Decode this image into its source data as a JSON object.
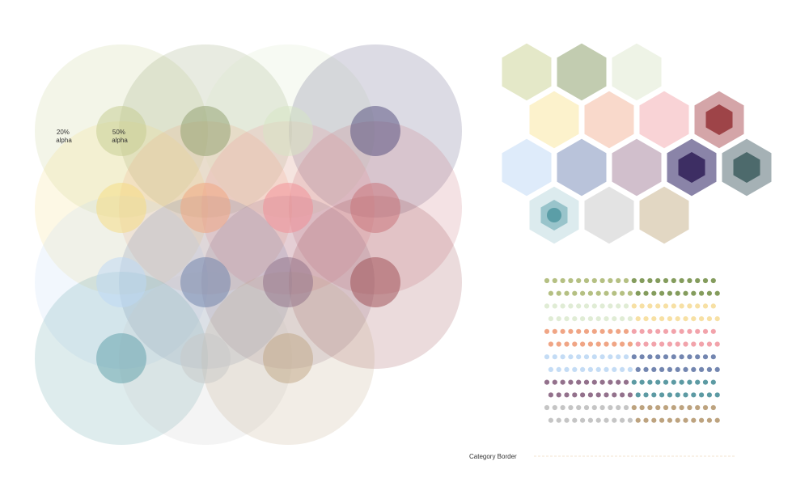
{
  "labels": {
    "alpha20": [
      "20%",
      "alpha"
    ],
    "alpha50": [
      "50%",
      "alpha"
    ],
    "category_border": "Category Border"
  },
  "colors": {
    "category_border": "#f3e3cf",
    "hex_border": "#ffffff",
    "label_text": "#333333"
  },
  "opacity": {
    "large": 0.2,
    "small": 0.5
  },
  "circle_grid": [
    [
      "#c3cc8d",
      "#8d9d6b",
      "#d6e6c4",
      "#4f4a7a"
    ],
    [
      "#f6dc7e",
      "#f1a37d",
      "#f28b93",
      "#c76f76"
    ],
    [
      "#bcd8f6",
      "#6c80a9",
      "#8e6e86",
      "#9b4a50"
    ],
    [
      "#5b9ea7",
      "#c7c7c7",
      "#bfa684",
      null
    ]
  ],
  "hex_swatches": [
    {
      "row": 0,
      "col": 0,
      "color": "#e4e8c8"
    },
    {
      "row": 0,
      "col": 1,
      "color": "#c2ccb0"
    },
    {
      "row": 0,
      "col": 2,
      "color": "#eef3e6"
    },
    {
      "row": 1,
      "col": 0,
      "color": "#fcf2cc"
    },
    {
      "row": 1,
      "col": 1,
      "color": "#f9d9cb"
    },
    {
      "row": 1,
      "col": 2,
      "color": "#f9d3d6"
    },
    {
      "row": 1,
      "col": 3,
      "color": "#d4a5a8",
      "inner": "#9e4448"
    },
    {
      "row": 2,
      "col": 0,
      "color": "#deebfa"
    },
    {
      "row": 2,
      "col": 1,
      "color": "#b9c3da"
    },
    {
      "row": 2,
      "col": 2,
      "color": "#d1bfcc"
    },
    {
      "row": 2,
      "col": 3,
      "color": "#8a84a8",
      "inner": "#3d2e63"
    },
    {
      "row": 2,
      "col": 4,
      "color": "#a5b1b5",
      "inner": "#4d6a6c"
    },
    {
      "row": 3,
      "col": 0,
      "color": "#dcebee",
      "inner": "#99c4cb",
      "inner2": "#5b9ea7"
    },
    {
      "row": 3,
      "col": 1,
      "color": "#e3e3e3"
    },
    {
      "row": 3,
      "col": 2,
      "color": "#e2d7c3"
    }
  ],
  "dot_rows": [
    [
      "#b5c083",
      "#849c5d"
    ],
    [
      "#b5c083",
      "#849c5d"
    ],
    [
      "#e0ecd5",
      "#f7e0a4"
    ],
    [
      "#e0ecd5",
      "#f7e0a4"
    ],
    [
      "#f0a585",
      "#f2a3ab"
    ],
    [
      "#f0a585",
      "#f2a3ab"
    ],
    [
      "#c4dcf5",
      "#7386b0"
    ],
    [
      "#c4dcf5",
      "#7386b0"
    ],
    [
      "#93718c",
      "#5c9aa3"
    ],
    [
      "#93718c",
      "#5c9aa3"
    ],
    [
      "#c5c5c5",
      "#bda37f"
    ],
    [
      "#c5c5c5",
      "#bda37f"
    ]
  ]
}
